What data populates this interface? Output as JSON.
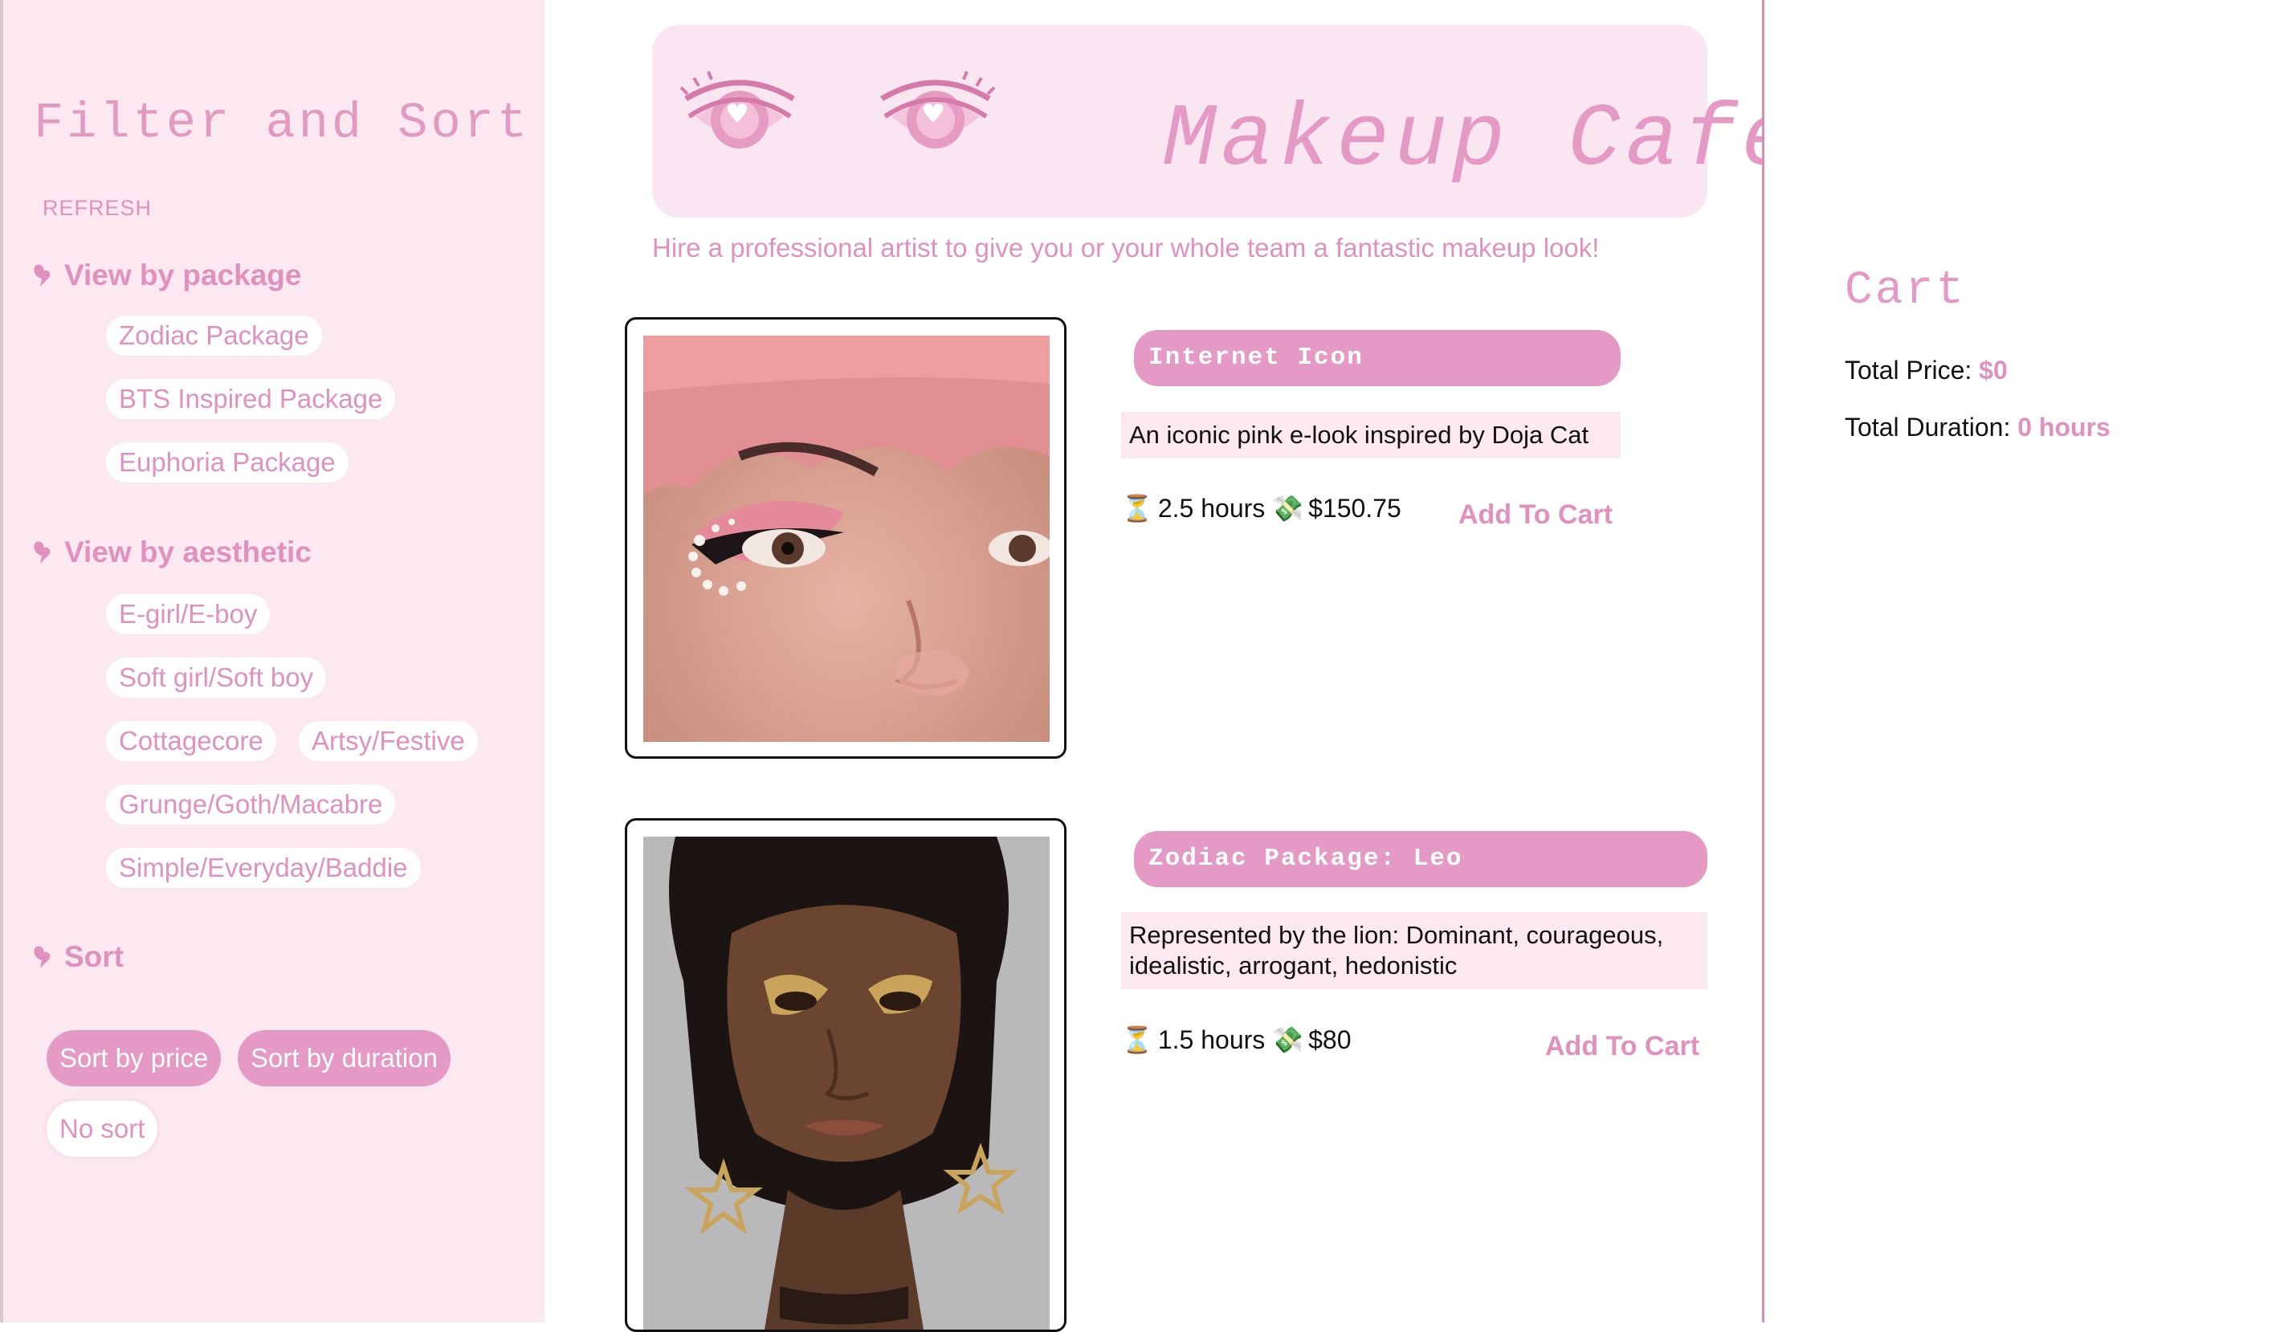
{
  "sidebar": {
    "title": "Filter and Sort",
    "refresh_label": "REFRESH",
    "package_section": {
      "heading": "View by package",
      "items": [
        "Zodiac Package",
        "BTS Inspired Package",
        "Euphoria Package"
      ]
    },
    "aesthetic_section": {
      "heading": "View by aesthetic",
      "items": [
        "E-girl/E-boy",
        "Soft girl/Soft boy",
        "Cottagecore",
        "Artsy/Festive",
        "Grunge/Goth/Macabre",
        "Simple/Everyday/Baddie"
      ]
    },
    "sort_section": {
      "heading": "Sort",
      "options": [
        "Sort by price",
        "Sort by duration",
        "No sort"
      ]
    }
  },
  "header": {
    "title": "Makeup Cafe",
    "tagline": "Hire a professional artist to give you or your whole team a fantastic makeup look!"
  },
  "products": [
    {
      "title": "Internet Icon",
      "description": "An iconic pink e-look inspired by Doja Cat",
      "duration": "2.5 hours",
      "price": "$150.75",
      "action": "Add To Cart"
    },
    {
      "title": "Zodiac Package: Leo",
      "description": "Represented by the lion: Dominant, courageous, idealistic, arrogant, hedonistic",
      "duration": "1.5 hours",
      "price": "$80",
      "action": "Add To Cart"
    }
  ],
  "cart": {
    "title": "Cart",
    "total_price_label": "Total Price:",
    "total_price_value": "$0",
    "total_duration_label": "Total Duration:",
    "total_duration_value": "0 hours"
  },
  "icons": {
    "section_arrow": "heart-arrow-icon",
    "duration": "hourglass-icon",
    "price": "money-icon",
    "banner_eyes": "pink-eye-icon"
  },
  "colors": {
    "accent": "#e49ac4",
    "accent_text": "#e091bd",
    "sidebar_bg": "#fbe8f1",
    "banner_bg": "#fae6f0"
  }
}
